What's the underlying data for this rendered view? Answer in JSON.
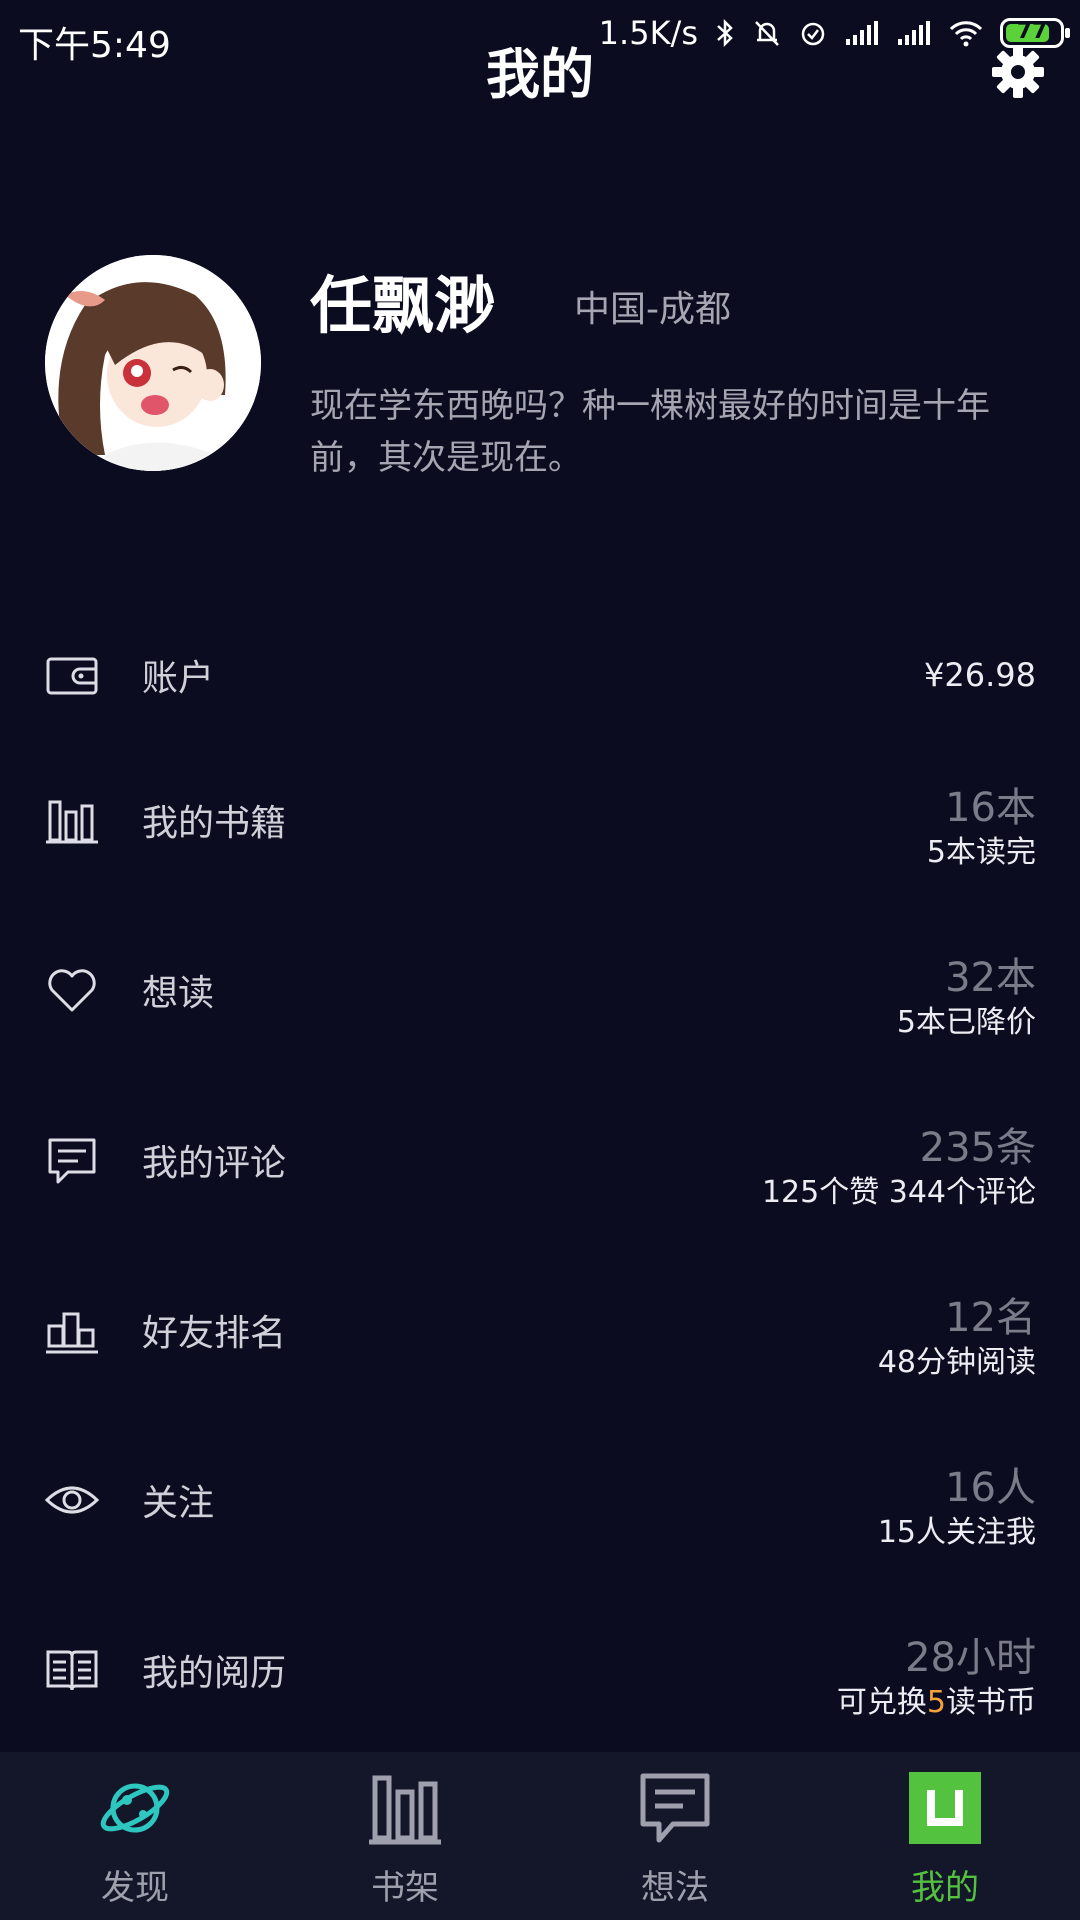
{
  "status_bar": {
    "time": "下午5:49",
    "net_speed": "1.5K/s",
    "battery": "77"
  },
  "header": {
    "title": "我的"
  },
  "profile": {
    "name": "任飘渺",
    "location": "中国-成都",
    "bio": "现在学东西晚吗？种一棵树最好的时间是十年前，其次是现在。"
  },
  "menu": {
    "account": {
      "label": "账户",
      "value": "¥26.98"
    },
    "books": {
      "label": "我的书籍",
      "main": "16本",
      "sub": "5本读完"
    },
    "wishlist": {
      "label": "想读",
      "main": "32本",
      "sub": "5本已降价"
    },
    "comments": {
      "label": "我的评论",
      "main": "235条",
      "sub": "125个赞 344个评论"
    },
    "ranking": {
      "label": "好友排名",
      "main": "12名",
      "sub": "48分钟阅读"
    },
    "follow": {
      "label": "关注",
      "main": "16人",
      "sub": "15人关注我"
    },
    "history": {
      "label": "我的阅历",
      "main": "28小时",
      "sub_prefix": "可兑换",
      "sub_highlight": "5",
      "sub_suffix": "读书币"
    }
  },
  "bottom_nav": {
    "discover": "发现",
    "bookshelf": "书架",
    "ideas": "想法",
    "mine": "我的"
  },
  "colors": {
    "background": "#0b0c1f",
    "active_tab": "#53c23e",
    "discover_icon": "#2ec7c0",
    "highlight": "#f3a23a"
  }
}
